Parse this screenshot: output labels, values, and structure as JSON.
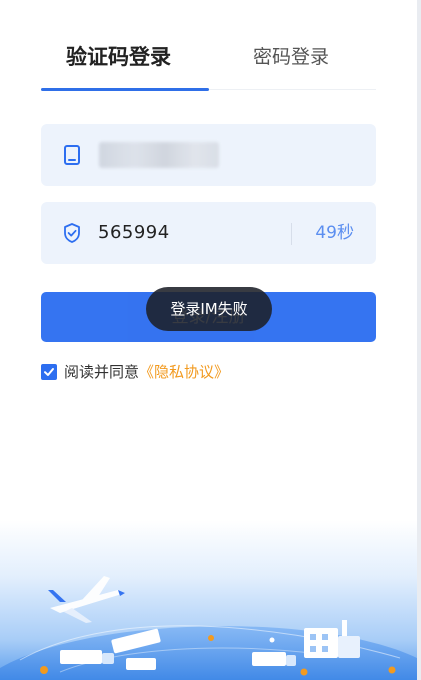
{
  "tabs": {
    "sms_login": "验证码登录",
    "password_login": "密码登录",
    "active": "sms_login"
  },
  "phone_field": {
    "icon": "phone-icon",
    "value_masked": true
  },
  "code_field": {
    "icon": "shield-check-icon",
    "value": "565994",
    "countdown": "49秒"
  },
  "login_button": {
    "label": "登录/注册"
  },
  "toast": {
    "message": "登录IM失败"
  },
  "agreement": {
    "checked": true,
    "text": "阅读并同意",
    "link": "《隐私协议》"
  },
  "colors": {
    "primary": "#2d6ef0",
    "field_bg": "#edf3fc",
    "link": "#f29a1f",
    "countdown": "#5b8ef0"
  }
}
